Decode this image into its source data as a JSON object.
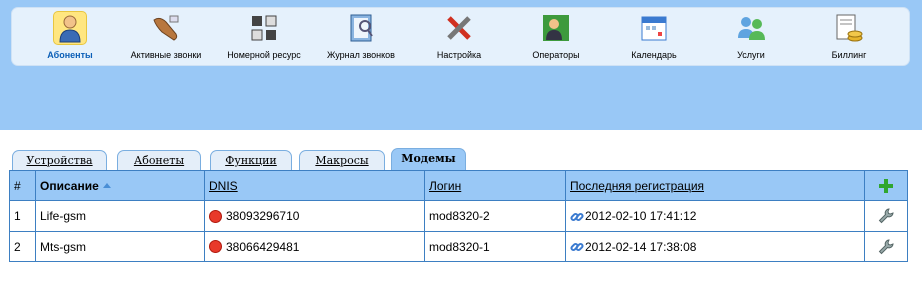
{
  "toolbar": {
    "items": [
      {
        "label": "Абоненты",
        "icon": "subscribers-icon",
        "active": true
      },
      {
        "label": "Активные звонки",
        "icon": "active-calls-icon",
        "active": false
      },
      {
        "label": "Номерной ресурс",
        "icon": "number-resource-icon",
        "active": false
      },
      {
        "label": "Журнал звонков",
        "icon": "call-log-icon",
        "active": false
      },
      {
        "label": "Настройка",
        "icon": "settings-tools-icon",
        "active": false
      },
      {
        "label": "Операторы",
        "icon": "operators-icon",
        "active": false
      },
      {
        "label": "Календарь",
        "icon": "calendar-icon",
        "active": false
      },
      {
        "label": "Услуги",
        "icon": "services-users-icon",
        "active": false
      },
      {
        "label": "Биллинг",
        "icon": "billing-coins-icon",
        "active": false
      }
    ]
  },
  "tabs": [
    {
      "label": "Устройства",
      "active": false
    },
    {
      "label": "Абонеты",
      "active": false
    },
    {
      "label": "Функции",
      "active": false
    },
    {
      "label": "Макросы",
      "active": false
    },
    {
      "label": "Модемы",
      "active": true
    }
  ],
  "table": {
    "headers": {
      "num": "#",
      "description": "Описание",
      "dnis": "DNIS",
      "login": "Логин",
      "last_registration": "Последняя регистрация"
    },
    "rows": [
      {
        "num": "1",
        "description": "Life-gsm",
        "dnis": "38093296710",
        "login": "mod8320-2",
        "last_registration": "2012-02-10 17:41:12"
      },
      {
        "num": "2",
        "description": "Mts-gsm",
        "dnis": "38066429481",
        "login": "mod8320-1",
        "last_registration": "2012-02-14 17:38:08"
      }
    ]
  },
  "colors": {
    "banner": "#99c8f6",
    "toolbar_bg": "#e5f1fc",
    "border": "#3d7fc2",
    "active_label": "#0b5fb7",
    "status_stop": "#e8392a",
    "add_green": "#2fa62f"
  }
}
